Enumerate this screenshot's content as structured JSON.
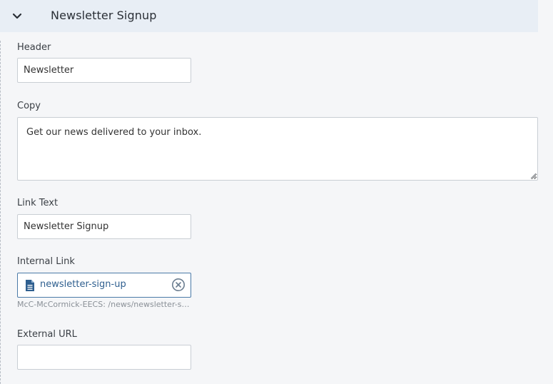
{
  "panel": {
    "title": "Newsletter Signup",
    "toggle_icon": "chevron-down-icon"
  },
  "fields": {
    "header": {
      "label": "Header",
      "value": "Newsletter"
    },
    "copy": {
      "label": "Copy",
      "value": "Get our news delivered to your inbox."
    },
    "link_text": {
      "label": "Link Text",
      "value": "Newsletter Signup"
    },
    "internal_link": {
      "label": "Internal Link",
      "value": "newsletter-sign-up",
      "path": "McC-McCormick-EECS: /news/newsletter-sign...",
      "icon": "document-icon",
      "clear_icon": "clear-circle-icon"
    },
    "external_url": {
      "label": "External URL",
      "value": ""
    }
  },
  "colors": {
    "header_bg": "#e8eef5",
    "page_bg": "#f5f6f8",
    "link_accent": "#2f5f8f",
    "focus_border": "#4a7aa8"
  }
}
